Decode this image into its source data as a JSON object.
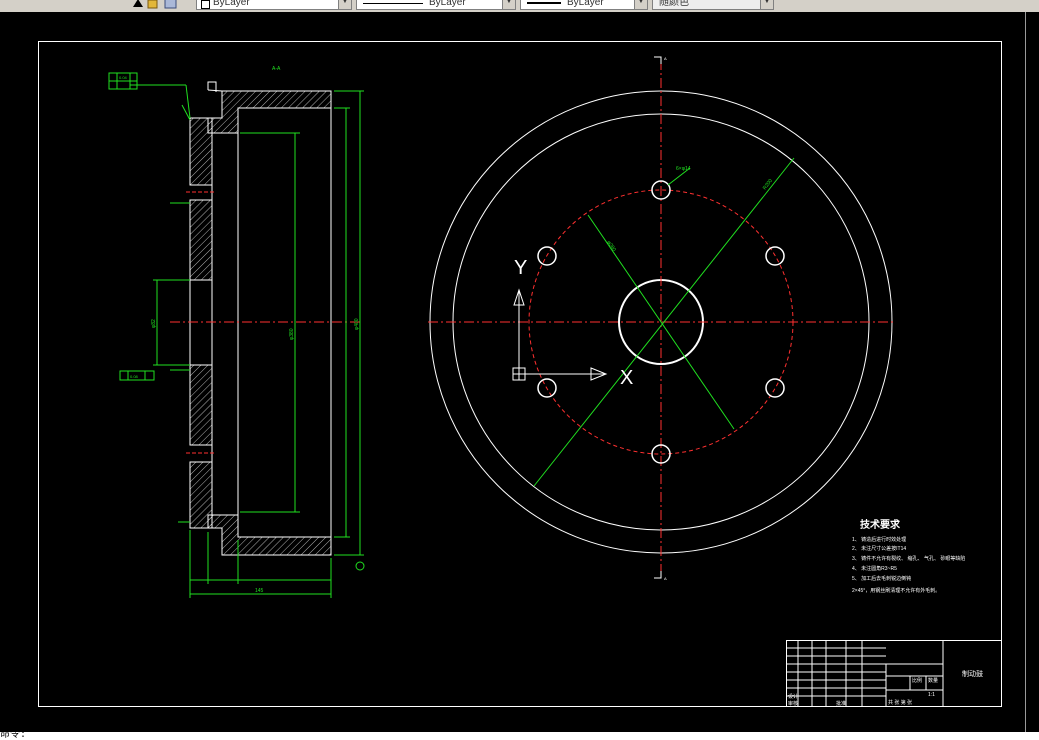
{
  "toolbar": {
    "color_combo": "ByLayer",
    "linetype_combo": "ByLayer",
    "lineweight_combo": "ByLayer",
    "plotstyle_combo": "随颜色"
  },
  "drawing": {
    "section_label": "A-A",
    "view_marker": "A",
    "ucs_y": "Y",
    "ucs_x": "X",
    "notes_title": "技术要求",
    "notes": [
      "1、 铸造后进行时效处理",
      "2、 未注尺寸公差按IT14",
      "3、 铸件不允许有裂纹、 缩孔、 气孔、 砂眼等缺陷",
      "4、 未注圆角R3~R5",
      "5、 加工后去毛刺锐边倒钝",
      "2×45°，用钢丝刷清理不允许有外毛刺。"
    ],
    "title_block": {
      "part_name": "制动鼓",
      "drawn": "设计",
      "check": "审核",
      "approve": "批准",
      "scale_label": "比例",
      "qty_label": "数量",
      "scale": "1:1",
      "sheet": "共 张 第 张"
    },
    "dims": {
      "outer_dia": "φ400",
      "inner_dia": "φ380",
      "hub": "φ82",
      "width": "145",
      "bolt_pcd": "φ280",
      "bolt_hole": "6×φ14",
      "r_outer": "R200",
      "tol_1": "0.04",
      "tol_2": "0.08"
    }
  },
  "command_line": "命令: "
}
